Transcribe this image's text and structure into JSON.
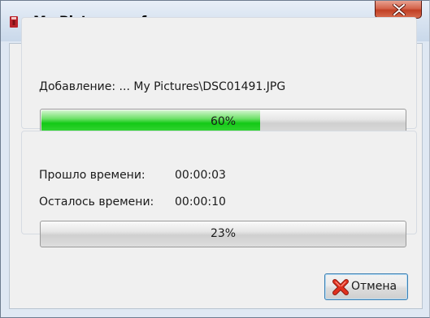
{
  "window": {
    "title": "My Pictures.acf"
  },
  "adding": {
    "label": "Добавление:  ... My Pictures\\DSC01491.JPG",
    "progress_percent": 60,
    "progress_text": "60%"
  },
  "time": {
    "elapsed_label": "Прошло времени:",
    "elapsed_value": "00:00:03",
    "remaining_label": "Осталось времени:",
    "remaining_value": "00:00:10"
  },
  "overall": {
    "progress_percent": 23,
    "progress_text": "23%"
  },
  "buttons": {
    "cancel_label": "Отмена"
  },
  "colors": {
    "progress_fill": "#13c916",
    "close_button": "#c13f24",
    "cancel_icon": "#e0301e"
  },
  "icons": {
    "app": "archive-icon",
    "close": "close-icon",
    "cancel": "cancel-x-icon"
  }
}
